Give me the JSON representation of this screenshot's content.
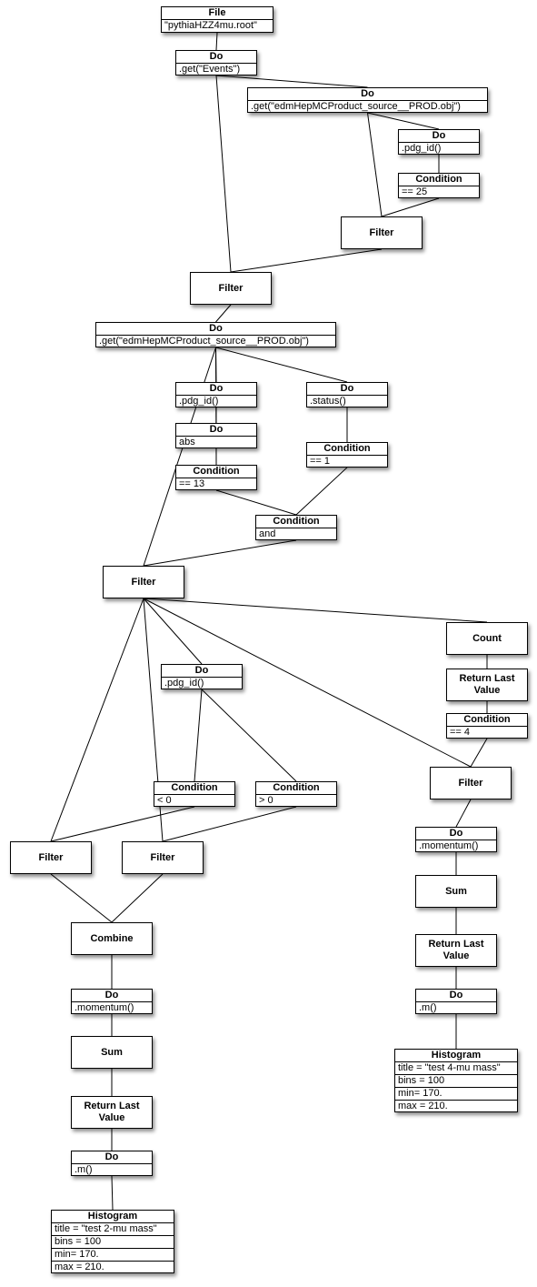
{
  "nodes": [
    {
      "id": 1,
      "title": "File",
      "rows": [
        "\"pythiaHZZ4mu.root\""
      ]
    },
    {
      "id": 2,
      "title": "Do",
      "rows": [
        ".get(\"Events\")"
      ]
    },
    {
      "id": 3,
      "title": "Do",
      "rows": [
        ".get(\"edmHepMCProduct_source__PROD.obj\")"
      ]
    },
    {
      "id": 4,
      "title": "Do",
      "rows": [
        ".pdg_id()"
      ]
    },
    {
      "id": 5,
      "title": "Condition",
      "rows": [
        "== 25"
      ]
    },
    {
      "id": 6,
      "title": "Filter",
      "rows": []
    },
    {
      "id": 7,
      "title": "Filter",
      "rows": []
    },
    {
      "id": 8,
      "title": "Do",
      "rows": [
        ".get(\"edmHepMCProduct_source__PROD.obj\")"
      ]
    },
    {
      "id": 9,
      "title": "Do",
      "rows": [
        ".pdg_id()"
      ]
    },
    {
      "id": 10,
      "title": "Do",
      "rows": [
        ".status()"
      ]
    },
    {
      "id": 11,
      "title": "Do",
      "rows": [
        "abs"
      ]
    },
    {
      "id": 12,
      "title": "Condition",
      "rows": [
        "== 1"
      ]
    },
    {
      "id": 13,
      "title": "Condition",
      "rows": [
        "== 13"
      ]
    },
    {
      "id": 14,
      "title": "Condition",
      "rows": [
        "and"
      ]
    },
    {
      "id": 15,
      "title": "Filter",
      "rows": []
    },
    {
      "id": 16,
      "title": "Count",
      "rows": []
    },
    {
      "id": 17,
      "title": "Return Last Value",
      "rows": []
    },
    {
      "id": 18,
      "title": "Condition",
      "rows": [
        "== 4"
      ]
    },
    {
      "id": 19,
      "title": "Do",
      "rows": [
        ".pdg_id()"
      ]
    },
    {
      "id": 20,
      "title": "Condition",
      "rows": [
        "< 0"
      ]
    },
    {
      "id": 21,
      "title": "Condition",
      "rows": [
        "> 0"
      ]
    },
    {
      "id": 22,
      "title": "Filter",
      "rows": []
    },
    {
      "id": 23,
      "title": "Filter",
      "rows": []
    },
    {
      "id": 24,
      "title": "Filter",
      "rows": []
    },
    {
      "id": 25,
      "title": "Do",
      "rows": [
        ".momentum()"
      ]
    },
    {
      "id": 26,
      "title": "Sum",
      "rows": []
    },
    {
      "id": 27,
      "title": "Return Last Value",
      "rows": []
    },
    {
      "id": 28,
      "title": "Combine",
      "rows": []
    },
    {
      "id": 29,
      "title": "Do",
      "rows": [
        ".m()"
      ]
    },
    {
      "id": 30,
      "title": "Do",
      "rows": [
        ".momentum()"
      ]
    },
    {
      "id": 31,
      "title": "Sum",
      "rows": []
    },
    {
      "id": 32,
      "title": "Histogram",
      "rows": [
        "title = \"test 4-mu mass\"",
        "bins = 100",
        "min= 170.",
        "max = 210."
      ]
    },
    {
      "id": 33,
      "title": "Return Last Value",
      "rows": []
    },
    {
      "id": 34,
      "title": "Do",
      "rows": [
        ".m()"
      ]
    },
    {
      "id": 35,
      "title": "Histogram",
      "rows": [
        "title = \"test 2-mu mass\"",
        "bins = 100",
        "min= 170.",
        "max = 210."
      ]
    }
  ],
  "edges": [
    [
      1,
      2
    ],
    [
      2,
      3
    ],
    [
      2,
      7
    ],
    [
      3,
      4
    ],
    [
      3,
      6
    ],
    [
      4,
      5
    ],
    [
      5,
      6
    ],
    [
      6,
      7
    ],
    [
      7,
      8
    ],
    [
      8,
      9
    ],
    [
      8,
      10
    ],
    [
      8,
      13
    ],
    [
      9,
      11
    ],
    [
      11,
      13
    ],
    [
      10,
      12
    ],
    [
      12,
      14
    ],
    [
      13,
      14
    ],
    [
      14,
      15
    ],
    [
      15,
      8
    ],
    [
      15,
      16
    ],
    [
      15,
      19
    ],
    [
      15,
      22
    ],
    [
      15,
      23
    ],
    [
      15,
      24
    ],
    [
      16,
      17
    ],
    [
      17,
      18
    ],
    [
      18,
      22
    ],
    [
      19,
      20
    ],
    [
      19,
      21
    ],
    [
      20,
      23
    ],
    [
      21,
      24
    ],
    [
      22,
      25
    ],
    [
      23,
      28
    ],
    [
      24,
      28
    ],
    [
      25,
      26
    ],
    [
      26,
      27
    ],
    [
      27,
      29
    ],
    [
      29,
      32
    ],
    [
      28,
      30
    ],
    [
      30,
      31
    ],
    [
      31,
      33
    ],
    [
      33,
      34
    ],
    [
      34,
      35
    ]
  ]
}
